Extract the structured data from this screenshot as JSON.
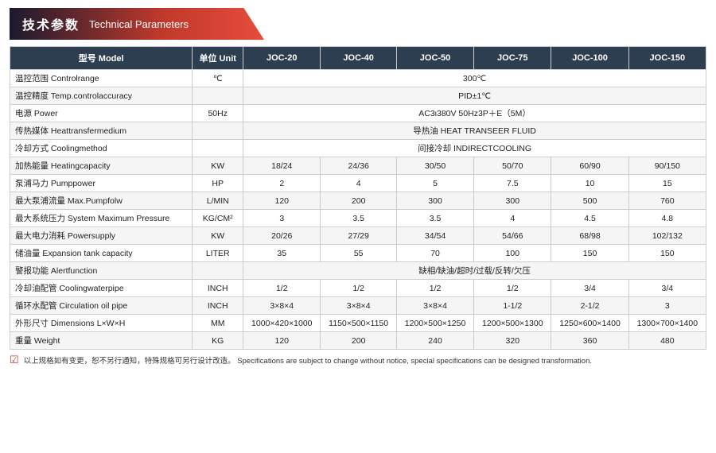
{
  "header": {
    "zh": "技术参数",
    "en": "Technical Parameters"
  },
  "table": {
    "columns": [
      "型号 Model",
      "单位 Unit",
      "JOC-20",
      "JOC-40",
      "JOC-50",
      "JOC-75",
      "JOC-100",
      "JOC-150"
    ],
    "rows": [
      {
        "label": "温控范围 Controlrange",
        "unit": "℃",
        "values": [
          "300℃",
          "",
          "",
          "",
          "",
          ""
        ],
        "span": true
      },
      {
        "label": "温控精度 Temp.controlaccuracy",
        "unit": "",
        "values": [
          "PID±1℃",
          "",
          "",
          "",
          "",
          ""
        ],
        "span": true
      },
      {
        "label": "电源 Power",
        "unit": "50Hz",
        "values": [
          "AC3ι380V 50Hz3P＋E（5M）",
          "",
          "",
          "",
          "",
          ""
        ],
        "span": true
      },
      {
        "label": "传热媒体 Heattransfermedium",
        "unit": "",
        "values": [
          "导热油 HEAT TRANSEER FLUID",
          "",
          "",
          "",
          "",
          ""
        ],
        "span": true
      },
      {
        "label": "冷却方式 Coolingmethod",
        "unit": "",
        "values": [
          "间接冷却 INDIRECTCOOLING",
          "",
          "",
          "",
          "",
          ""
        ],
        "span": true
      },
      {
        "label": "加热能量 Heatingcapacity",
        "unit": "KW",
        "values": [
          "18/24",
          "24/36",
          "30/50",
          "50/70",
          "60/90",
          "90/150"
        ],
        "span": false
      },
      {
        "label": "泵浦马力 Pumppower",
        "unit": "HP",
        "values": [
          "2",
          "4",
          "5",
          "7.5",
          "10",
          "15"
        ],
        "span": false
      },
      {
        "label": "最大泵浦流量 Max.Pumpfolw",
        "unit": "L/MIN",
        "values": [
          "120",
          "200",
          "300",
          "300",
          "500",
          "760"
        ],
        "span": false
      },
      {
        "label": "最大系统压力 System Maximum Pressure",
        "unit": "KG/CM²",
        "values": [
          "3",
          "3.5",
          "3.5",
          "4",
          "4.5",
          "4.8"
        ],
        "span": false
      },
      {
        "label": "最大电力消耗 Powersupply",
        "unit": "KW",
        "values": [
          "20/26",
          "27/29",
          "34/54",
          "54/66",
          "68/98",
          "102/132"
        ],
        "span": false
      },
      {
        "label": "储油量 Expansion tank capacity",
        "unit": "LITER",
        "values": [
          "35",
          "55",
          "70",
          "100",
          "150",
          "150"
        ],
        "span": false
      },
      {
        "label": "警报功能 Alertfunction",
        "unit": "",
        "values": [
          "缺相/缺油/超时/过载/反转/欠压",
          "",
          "",
          "",
          "",
          ""
        ],
        "span": true
      },
      {
        "label": "冷却油配管 Coolingwaterpipe",
        "unit": "INCH",
        "values": [
          "1/2",
          "1/2",
          "1/2",
          "1/2",
          "3/4",
          "3/4"
        ],
        "span": false
      },
      {
        "label": "循环水配管 Circulation oil pipe",
        "unit": "INCH",
        "values": [
          "3×8×4",
          "3×8×4",
          "3×8×4",
          "1-1/2",
          "2-1/2",
          "3"
        ],
        "span": false
      },
      {
        "label": "外形尺寸 Dimensions L×W×H",
        "unit": "MM",
        "values": [
          "1000×420×1000",
          "1150×500×1150",
          "1200×500×1250",
          "1200×500×1300",
          "1250×600×1400",
          "1300×700×1400"
        ],
        "span": false
      },
      {
        "label": "重量 Weight",
        "unit": "KG",
        "values": [
          "120",
          "200",
          "240",
          "320",
          "360",
          "480"
        ],
        "span": false
      }
    ]
  },
  "footer": {
    "note": "以上规格如有变更，恕不另行通知，特殊规格可另行设计改造。  Specifications are subject to change without notice, special specifications can be designed transformation."
  }
}
